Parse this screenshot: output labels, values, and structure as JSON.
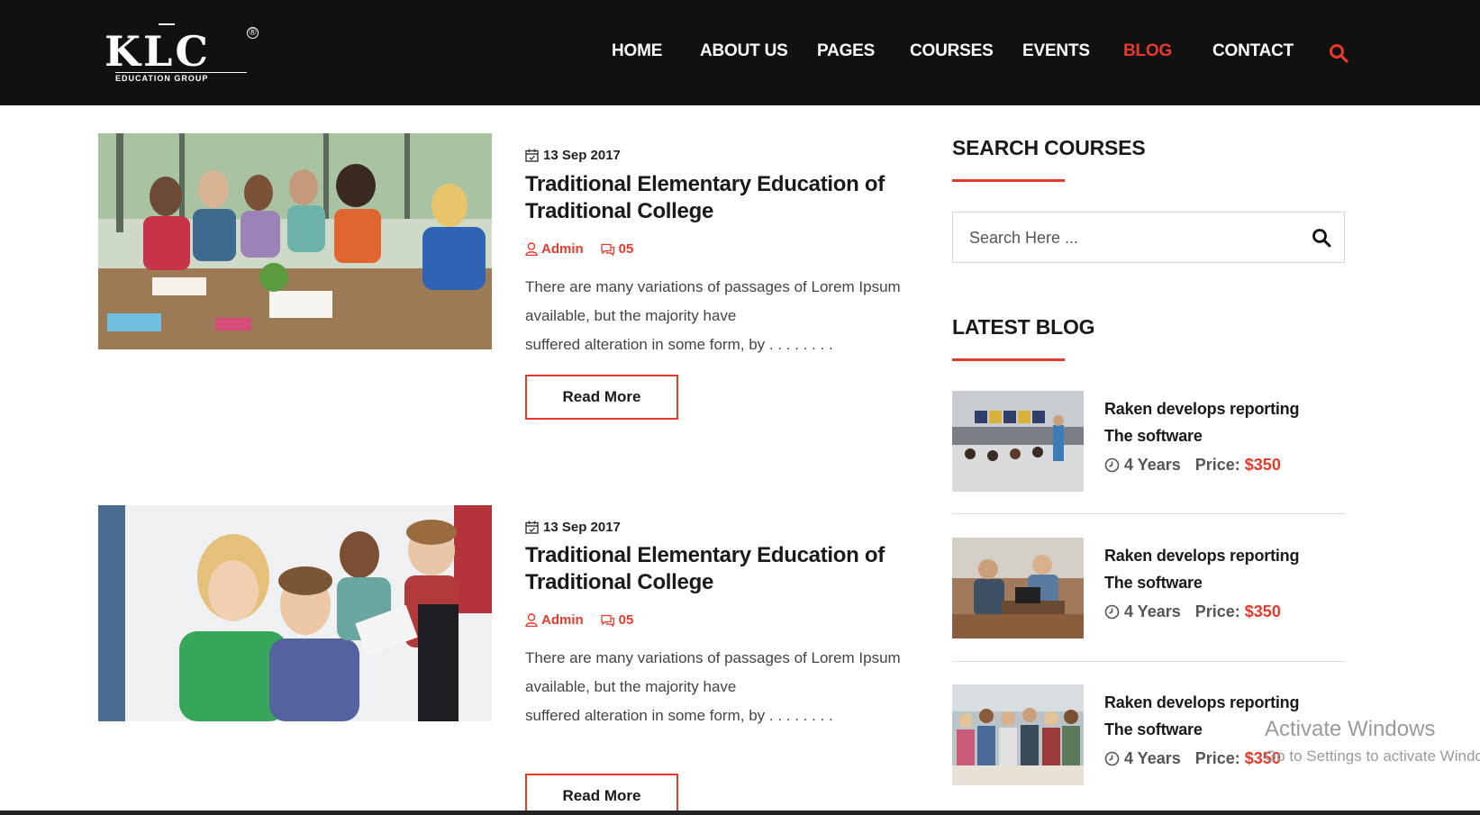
{
  "brand": {
    "logo_text": "KLC",
    "logo_subtitle": "EDUCATION GROUP",
    "logo_mark": "®"
  },
  "nav": {
    "items": [
      {
        "label": "HOME"
      },
      {
        "label": "ABOUT US"
      },
      {
        "label": "PAGES"
      },
      {
        "label": "COURSES"
      },
      {
        "label": "EVENTS"
      },
      {
        "label": "BLOG"
      },
      {
        "label": "CONTACT"
      }
    ],
    "active": "BLOG",
    "search_icon": "search-icon"
  },
  "posts": [
    {
      "date": "13 Sep 2017",
      "title": "Traditional Elementary Education of Traditional College",
      "author": "Admin",
      "comments": "05",
      "excerpt_lines": [
        "There are many variations of passages of Lorem Ipsum",
        "available, but the majority have",
        "suffered alteration in some form, by . . . . . . . ."
      ],
      "read_more": "Read More",
      "image": "students-around-table-photo"
    },
    {
      "date": "13 Sep 2017",
      "title": "Traditional Elementary Education of Traditional College",
      "author": "Admin",
      "comments": "05",
      "excerpt_lines": [
        "There are many variations of passages of Lorem Ipsum",
        "available, but the majority have",
        "suffered alteration in some form, by . . . . . . . ."
      ],
      "read_more": "Read More",
      "image": "students-at-computer-photo"
    }
  ],
  "sidebar": {
    "search_heading": "SEARCH COURSES",
    "search_placeholder": "Search Here ...",
    "latest_heading": "LATEST BLOG",
    "latest_items": [
      {
        "title": "Raken develops reporting The software",
        "duration": "4 Years",
        "price_label": "Price:",
        "price": "$350",
        "image": "lecture-hall-photo"
      },
      {
        "title": "Raken develops reporting The software",
        "duration": "4 Years",
        "price_label": "Price:",
        "price": "$350",
        "image": "students-studying-photo"
      },
      {
        "title": "Raken develops reporting The software",
        "duration": "4 Years",
        "price_label": "Price:",
        "price": "$350",
        "image": "class-group-photo"
      }
    ]
  },
  "watermark": {
    "title": "Activate Windows",
    "subtitle": "Go to Settings to activate Windows."
  },
  "colors": {
    "accent": "#e83a2b",
    "header_bg": "#111111",
    "text_dark": "#1a1a1a"
  }
}
